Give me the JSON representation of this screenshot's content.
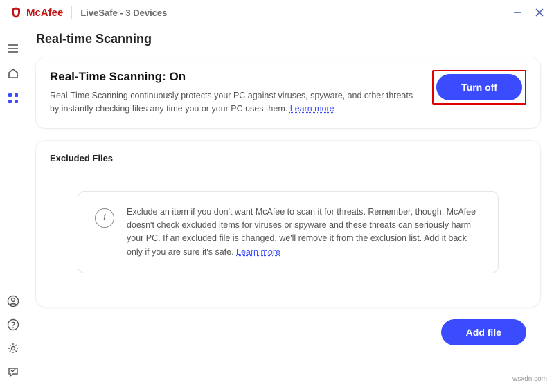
{
  "titlebar": {
    "brand": "McAfee",
    "product": "LiveSafe - 3 Devices"
  },
  "page": {
    "title": "Real-time Scanning"
  },
  "rts": {
    "heading": "Real-Time Scanning: On",
    "description": "Real-Time Scanning continuously protects your PC against viruses, spyware, and other threats by instantly checking files any time you or your PC uses them. ",
    "learn_more": "Learn more",
    "turn_off": "Turn off"
  },
  "excluded": {
    "title": "Excluded Files",
    "info": "Exclude an item if you don't want McAfee to scan it for threats. Remember, though, McAfee doesn't check excluded items for viruses or spyware and these threats can seriously harm your PC. If an excluded file is changed, we'll remove it from the exclusion list. Add it back only if you are sure it's safe. ",
    "learn_more": "Learn more",
    "add_file": "Add file"
  },
  "watermark": "wsxdn.com"
}
